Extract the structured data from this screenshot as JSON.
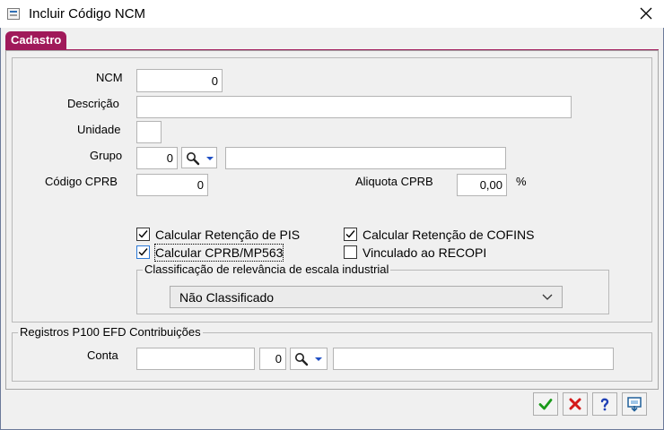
{
  "window": {
    "title": "Incluir Código NCM"
  },
  "tabs": [
    {
      "label": "Cadastro"
    }
  ],
  "form": {
    "ncm": {
      "label": "NCM",
      "value": "0"
    },
    "descricao": {
      "label": "Descrição",
      "value": ""
    },
    "unidade": {
      "label": "Unidade",
      "value": ""
    },
    "grupo": {
      "label": "Grupo",
      "code": "0",
      "name": ""
    },
    "codigo_cprb": {
      "label": "Código CPRB",
      "value": "0"
    },
    "aliquota_cprb": {
      "label": "Aliquota CPRB",
      "value": "0,00",
      "unit": "%"
    }
  },
  "checkboxes": [
    {
      "label": "Calcular Retenção de PIS",
      "checked": true
    },
    {
      "label": "Calcular Retenção de COFINS",
      "checked": true
    },
    {
      "label": "Calcular CPRB/MP563",
      "checked": true,
      "focused": true
    },
    {
      "label": "Vinculado ao RECOPI",
      "checked": false
    }
  ],
  "classificacao": {
    "legend": "Classificação de relevância de escala industrial",
    "selected": "Não Classificado"
  },
  "registros": {
    "legend": "Registros P100 EFD Contribuições",
    "conta": {
      "label": "Conta",
      "value": "",
      "code": "0",
      "name": ""
    }
  },
  "buttons": [
    {
      "name": "confirm",
      "icon": "check-icon",
      "color": "#1a9a1a"
    },
    {
      "name": "cancel",
      "icon": "x-icon",
      "color": "#d41a1a"
    },
    {
      "name": "help",
      "icon": "question-icon",
      "color": "#1f3fb5"
    },
    {
      "name": "print",
      "icon": "printer-icon",
      "color": "#1f5f99"
    }
  ]
}
